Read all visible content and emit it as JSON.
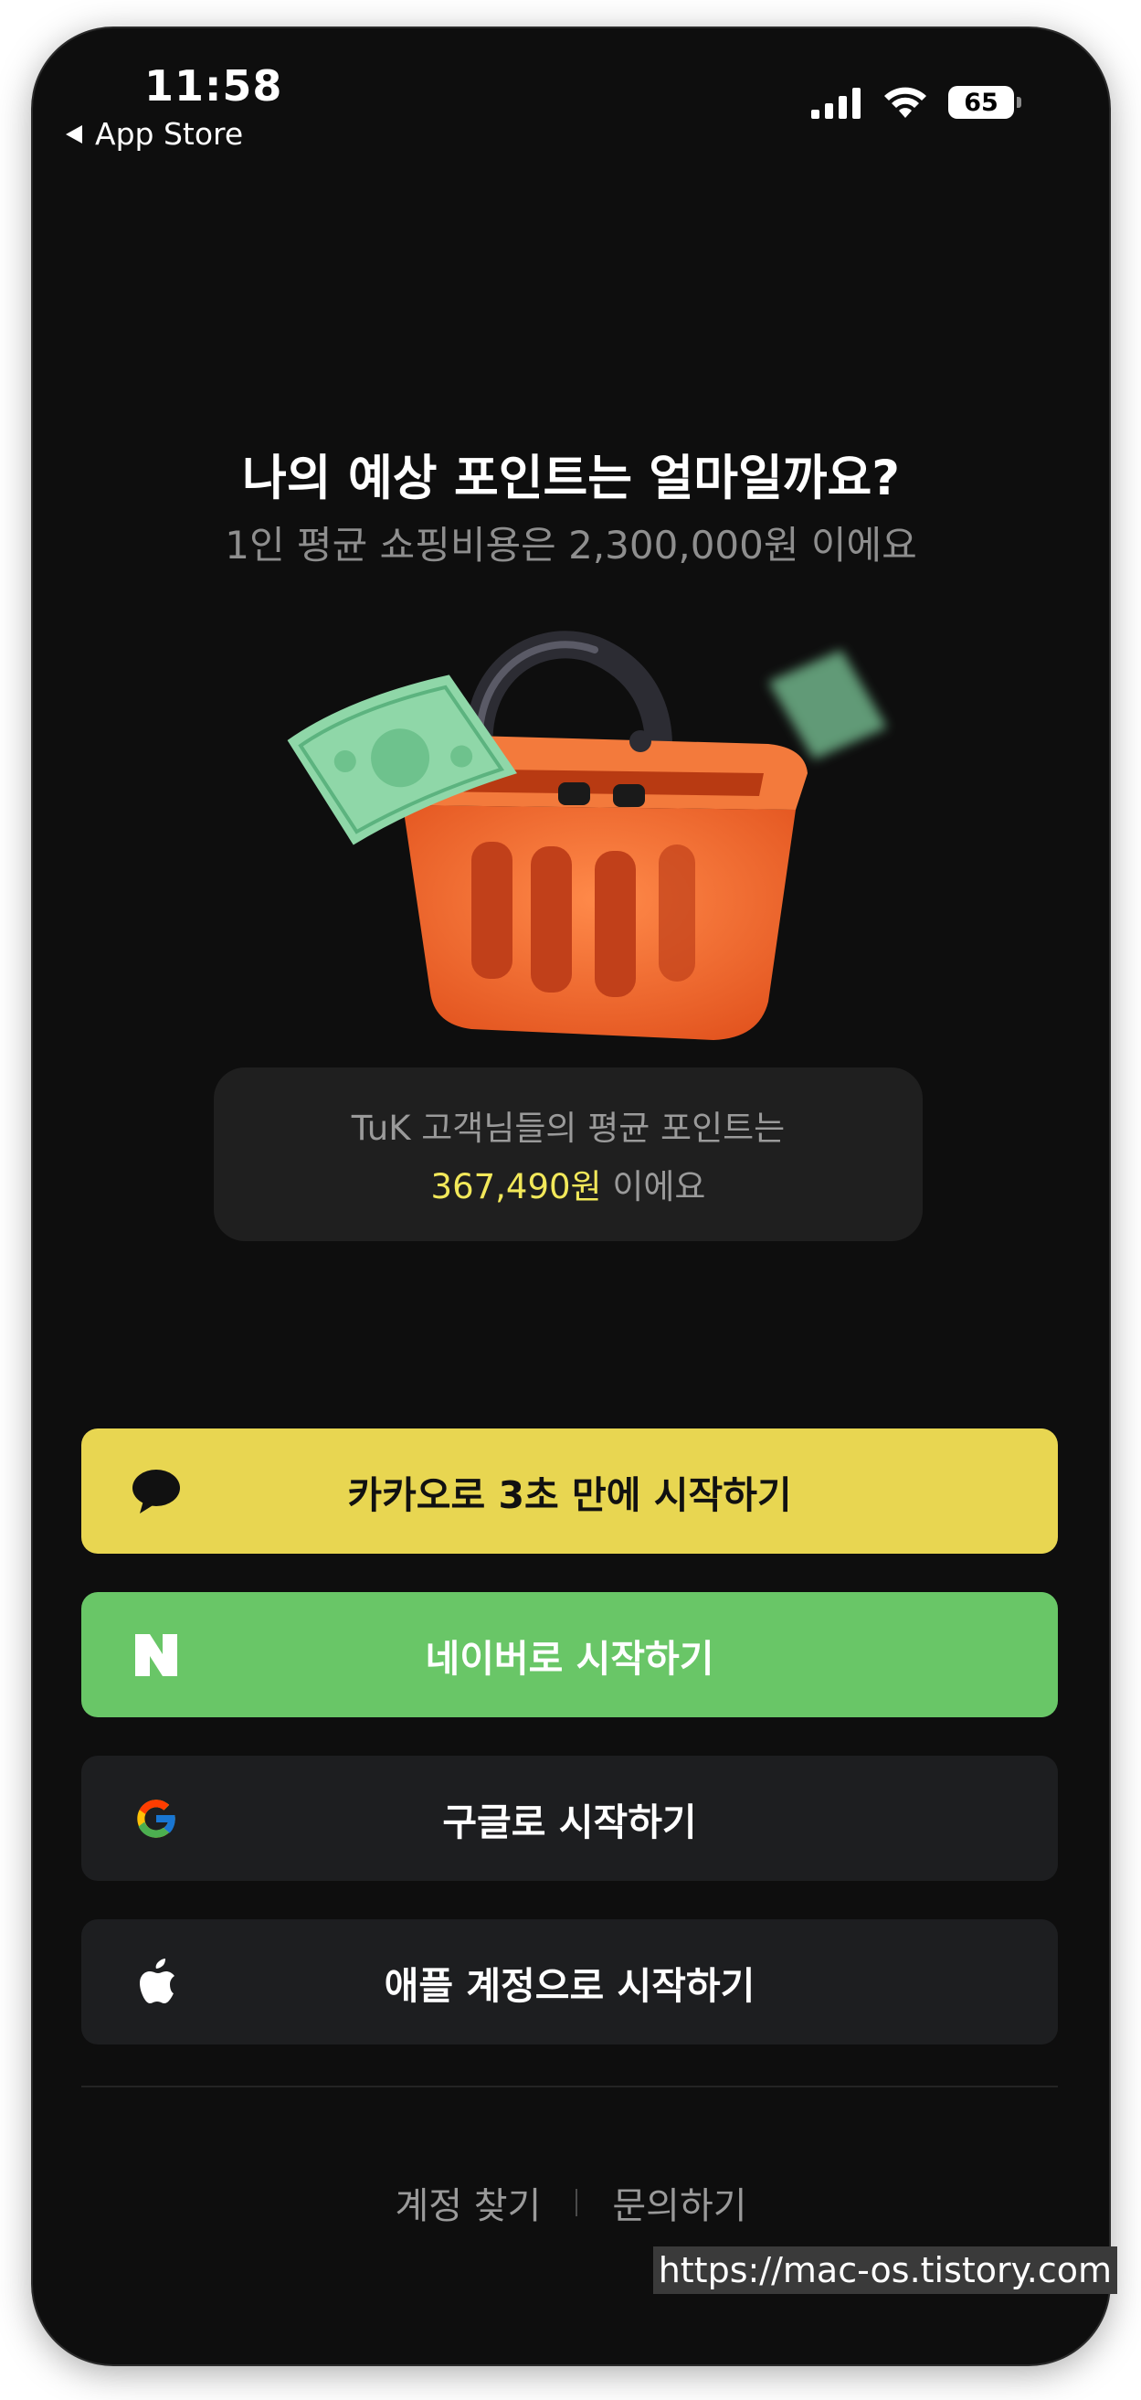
{
  "status_bar": {
    "time": "11:58",
    "back_label": "App Store",
    "battery": "65"
  },
  "hero": {
    "title": "나의 예상 포인트는 얼마일까요?",
    "subtitle": "1인 평균 쇼핑비용은 2,300,000원 이에요"
  },
  "info": {
    "line1": "TuK 고객님들의 평균 포인트는",
    "amount": "367,490원",
    "suffix": " 이에요"
  },
  "buttons": {
    "kakao": "카카오로 3초 만에 시작하기",
    "naver": "네이버로 시작하기",
    "google": "구글로 시작하기",
    "apple": "애플 계정으로 시작하기"
  },
  "footer": {
    "find_account": "계정 찾기",
    "inquiry": "문의하기"
  },
  "watermark": "https://mac-os.tistory.com",
  "colors": {
    "kakao": "#e8d651",
    "naver": "#69c667",
    "dark_button": "#1d1e20",
    "amount": "#f2e85a",
    "basket": "#f06a2e"
  }
}
